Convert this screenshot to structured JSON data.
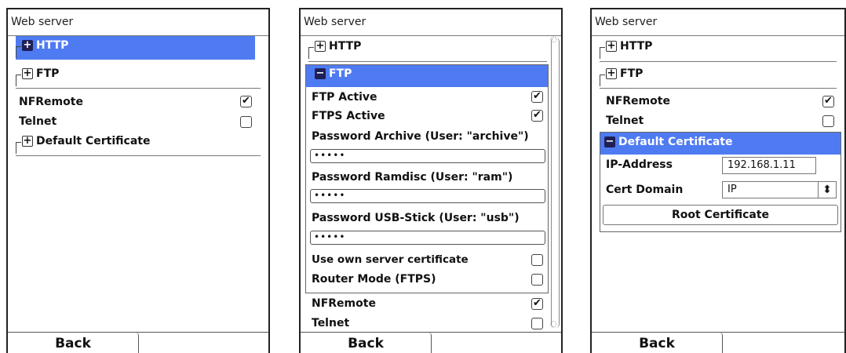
{
  "panels": [
    {
      "title": "Web server",
      "groups": {
        "http": "HTTP",
        "ftp": "FTP",
        "cert": "Default Certificate"
      },
      "rows": {
        "nfremote": "NFRemote",
        "telnet": "Telnet"
      },
      "nfremote_checked": "✔",
      "back": "Back"
    },
    {
      "title": "Web server",
      "groups": {
        "http": "HTTP",
        "ftp": "FTP"
      },
      "ftp_rows": {
        "ftp_active": "FTP Active",
        "ftps_active": "FTPS Active",
        "pw_archive_label": "Password Archive (User: \"archive\")",
        "pw_archive_value": "•••••",
        "pw_ramdisc_label": "Password Ramdisc (User: \"ram\")",
        "pw_ramdisc_value": "•••••",
        "pw_usb_label": "Password USB-Stick (User: \"usb\")",
        "pw_usb_value": "•••••",
        "own_cert": "Use own server certificate",
        "router_mode": "Router Mode (FTPS)"
      },
      "rows": {
        "nfremote": "NFRemote",
        "telnet": "Telnet"
      },
      "check": "✔",
      "back": "Back"
    },
    {
      "title": "Web server",
      "groups": {
        "http": "HTTP",
        "ftp": "FTP",
        "cert": "Default Certificate"
      },
      "rows": {
        "nfremote": "NFRemote",
        "telnet": "Telnet"
      },
      "cert_rows": {
        "ip_label": "IP-Address",
        "ip_value": "192.168.1.11",
        "domain_label": "Cert Domain",
        "domain_value": "IP",
        "root_button": "Root Certificate"
      },
      "check": "✔",
      "back": "Back"
    }
  ],
  "icons": {
    "plus": "+",
    "minus": "−",
    "updown": "⬍",
    "scroll_up": "◌",
    "scroll_down": "◌"
  },
  "colors": {
    "selected": "#4f7bf2",
    "icon_dark": "#1f1f55"
  }
}
